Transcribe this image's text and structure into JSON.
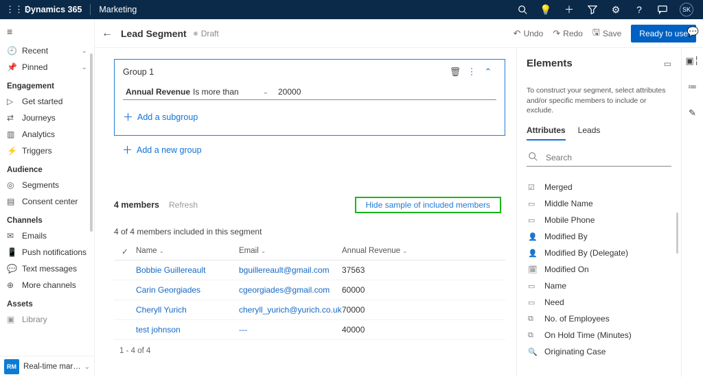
{
  "topbar": {
    "brand": "Dynamics 365",
    "module": "Marketing",
    "avatar": "SK"
  },
  "sidebar": {
    "recent": "Recent",
    "pinned": "Pinned",
    "sections": {
      "engagement": {
        "title": "Engagement",
        "items": [
          "Get started",
          "Journeys",
          "Analytics",
          "Triggers"
        ]
      },
      "audience": {
        "title": "Audience",
        "items": [
          "Segments",
          "Consent center"
        ]
      },
      "channels": {
        "title": "Channels",
        "items": [
          "Emails",
          "Push notifications",
          "Text messages",
          "More channels"
        ]
      },
      "assets": {
        "title": "Assets",
        "items": [
          "Library"
        ]
      }
    },
    "footer": {
      "sq": "RM",
      "label": "Real-time marketi..."
    }
  },
  "cmdbar": {
    "title": "Lead Segment",
    "status": "Draft",
    "undo": "Undo",
    "redo": "Redo",
    "save": "Save",
    "primary": "Ready to use"
  },
  "group": {
    "title": "Group 1",
    "attr": "Annual Revenue",
    "op": "Is more than",
    "val": "20000",
    "add_sub": "Add a subgroup",
    "add_group": "Add a new group"
  },
  "members": {
    "count_label": "4 members",
    "refresh": "Refresh",
    "hide": "Hide sample of included members",
    "summary": "4 of 4 members included in this segment",
    "cols": {
      "name": "Name",
      "email": "Email",
      "rev": "Annual Revenue"
    },
    "rows": [
      {
        "name": "Bobbie Guillereault",
        "email": "bguillereault@gmail.com",
        "rev": "37563"
      },
      {
        "name": "Carin Georgiades",
        "email": "cgeorgiades@gmail.com",
        "rev": "60000"
      },
      {
        "name": "Cheryll Yurich",
        "email": "cheryll_yurich@yurich.co.uk",
        "rev": "70000"
      },
      {
        "name": "test johnson",
        "email": "---",
        "rev": "40000"
      }
    ],
    "pager": "1 - 4 of 4"
  },
  "elements": {
    "title": "Elements",
    "desc": "To construct your segment, select attributes and/or specific members to include or exclude.",
    "tabs": {
      "attributes": "Attributes",
      "leads": "Leads"
    },
    "search_placeholder": "Search",
    "attrs": [
      {
        "icon": "☑",
        "label": "Merged"
      },
      {
        "icon": "▭",
        "label": "Middle Name"
      },
      {
        "icon": "▭",
        "label": "Mobile Phone"
      },
      {
        "icon": "👤",
        "label": "Modified By"
      },
      {
        "icon": "👤",
        "label": "Modified By (Delegate)"
      },
      {
        "icon": "🗓",
        "label": "Modified On"
      },
      {
        "icon": "▭",
        "label": "Name"
      },
      {
        "icon": "▭",
        "label": "Need"
      },
      {
        "icon": "⧉",
        "label": "No. of Employees"
      },
      {
        "icon": "⧉",
        "label": "On Hold Time (Minutes)"
      },
      {
        "icon": "🔍",
        "label": "Originating Case"
      }
    ]
  }
}
